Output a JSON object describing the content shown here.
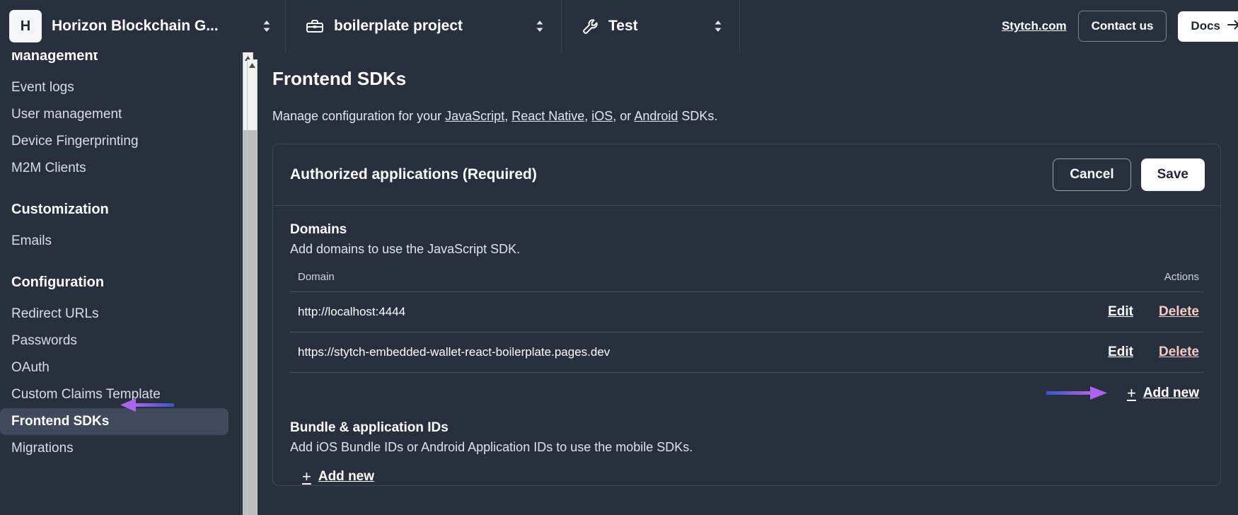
{
  "topbar": {
    "org": {
      "badge": "H",
      "name": "Horizon Blockchain G...",
      "selector_icon": "chevron-updown-icon"
    },
    "project": {
      "icon": "toolbox-icon",
      "name": "boilerplate project",
      "selector_icon": "chevron-updown-icon"
    },
    "environment": {
      "icon": "wrench-icon",
      "name": "Test",
      "selector_icon": "chevron-updown-icon"
    },
    "stytch_link": "Stytch.com",
    "contact_button": "Contact us",
    "docs_button": "Docs",
    "docs_icon": "arrow-right-icon"
  },
  "sidebar": {
    "sections": [
      {
        "title": "Management",
        "items": [
          {
            "label": "Event logs",
            "active": false
          },
          {
            "label": "User management",
            "active": false
          },
          {
            "label": "Device Fingerprinting",
            "active": false
          },
          {
            "label": "M2M Clients",
            "active": false
          }
        ]
      },
      {
        "title": "Customization",
        "items": [
          {
            "label": "Emails",
            "active": false
          }
        ]
      },
      {
        "title": "Configuration",
        "items": [
          {
            "label": "Redirect URLs",
            "active": false
          },
          {
            "label": "Passwords",
            "active": false
          },
          {
            "label": "OAuth",
            "active": false
          },
          {
            "label": "Custom Claims Template",
            "active": false
          },
          {
            "label": "Frontend SDKs",
            "active": true
          },
          {
            "label": "Migrations",
            "active": false
          }
        ]
      }
    ]
  },
  "main": {
    "title": "Frontend SDKs",
    "subtitle": {
      "prefix": "Manage configuration for your ",
      "links": [
        "JavaScript",
        "React Native",
        "iOS",
        "Android"
      ],
      "sep1": ", ",
      "sep2": ", ",
      "sep3": ", or ",
      "suffix": " SDKs."
    },
    "card": {
      "title": "Authorized applications (Required)",
      "cancel_label": "Cancel",
      "save_label": "Save",
      "domains": {
        "title": "Domains",
        "description": "Add domains to use the JavaScript SDK.",
        "columns": [
          "Domain",
          "Actions"
        ],
        "rows": [
          {
            "domain": "http://localhost:4444",
            "edit": "Edit",
            "delete": "Delete"
          },
          {
            "domain": "https://stytch-embedded-wallet-react-boilerplate.pages.dev",
            "edit": "Edit",
            "delete": "Delete"
          }
        ],
        "add_new": "Add new"
      },
      "bundle": {
        "title": "Bundle & application IDs",
        "description": "Add iOS Bundle IDs or Android Application IDs to use the mobile SDKs.",
        "add_new": "Add new"
      }
    }
  },
  "annotations": {
    "arrow_color_start": "#3b55c8",
    "arrow_color_end": "#a965ec",
    "sidebar_arrow": "left-arrow-annotation",
    "addnew_arrow": "right-arrow-annotation"
  },
  "colors": {
    "background": "#28303e",
    "border": "#3e4759",
    "active_item": "#404a5c",
    "delete_text": "#f2ccc5",
    "accent_white": "#ffffff"
  }
}
